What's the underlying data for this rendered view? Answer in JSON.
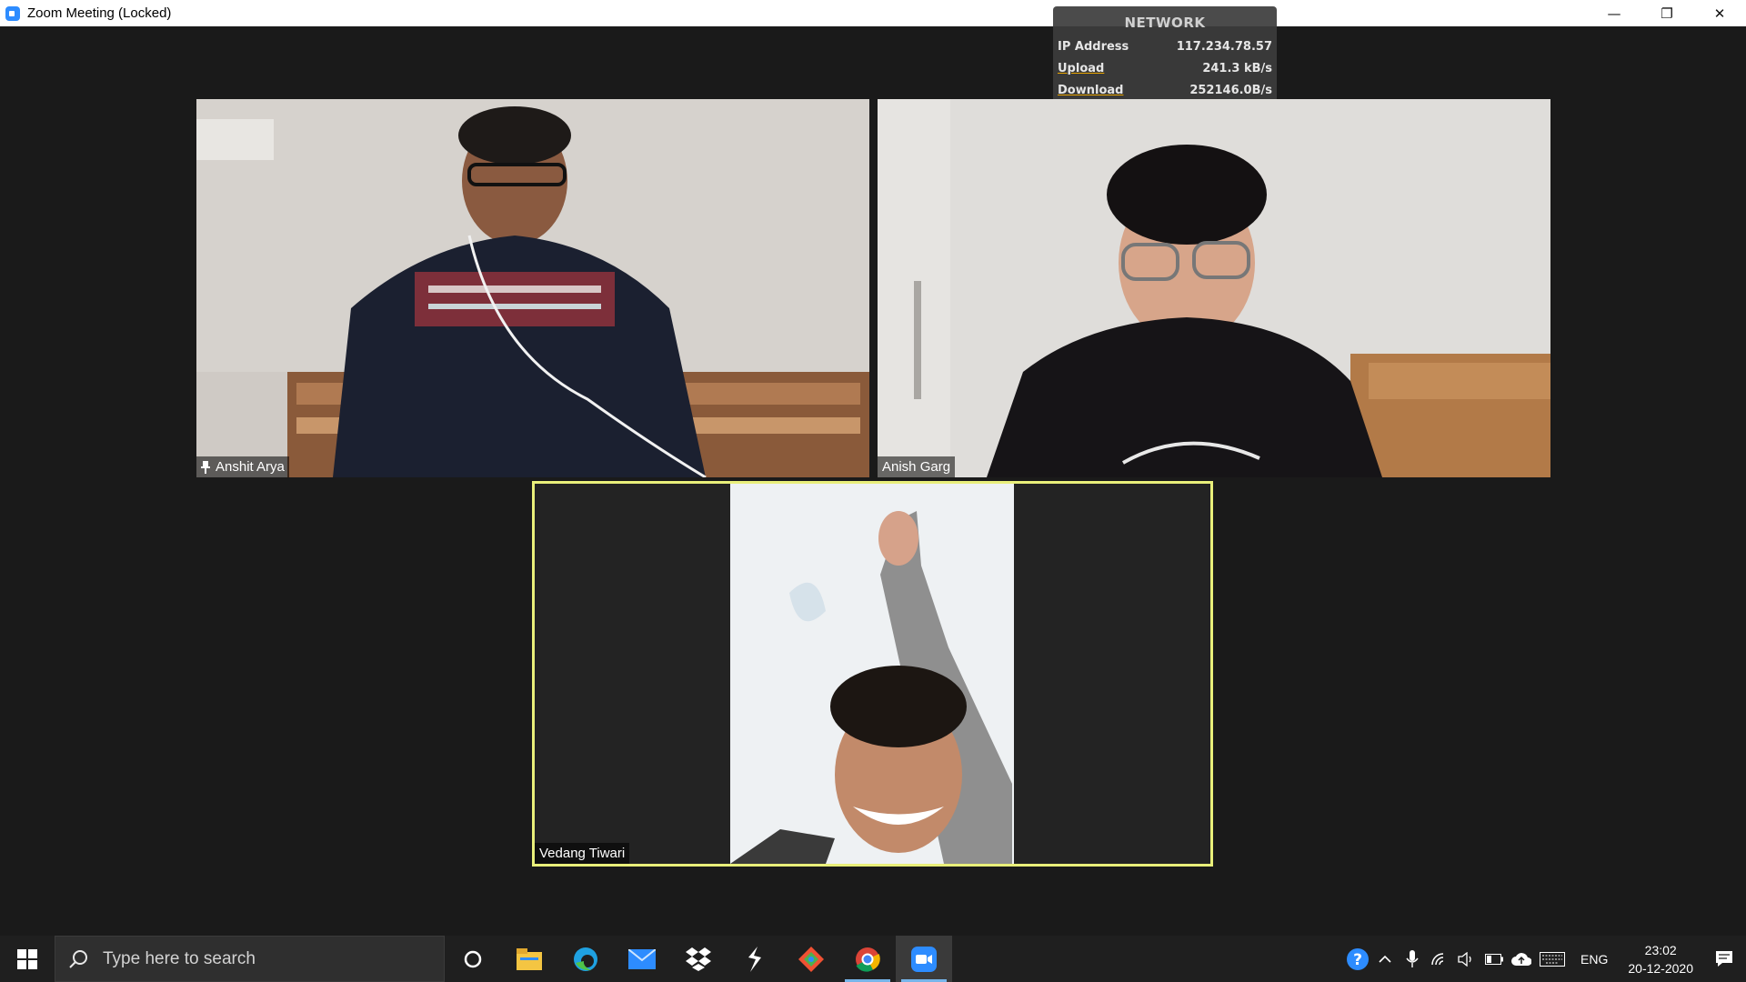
{
  "window": {
    "title": "Zoom Meeting (Locked)",
    "minimize_glyph": "—",
    "restore_glyph": "❐",
    "close_glyph": "✕",
    "app_icon": "zoom-icon"
  },
  "network_overlay": {
    "title": "NETWORK",
    "rows": [
      {
        "label": "IP Address",
        "value": "117.234.78.57"
      },
      {
        "label": "Upload",
        "value": "241.3 kB/s"
      },
      {
        "label": "Download",
        "value": "252146.0B/s"
      }
    ]
  },
  "participants": [
    {
      "name": "Anshit Arya",
      "pinned": true
    },
    {
      "name": "Anish Garg",
      "pinned": false
    },
    {
      "name": "Vedang Tiwari",
      "active_speaker": true
    }
  ],
  "taskbar": {
    "search_placeholder": "Type here to search",
    "apps": [
      "cortana-icon",
      "file-explorer-icon",
      "edge-icon",
      "mail-icon",
      "dropbox-icon",
      "sublime-icon",
      "git-icon",
      "chrome-icon",
      "zoom-icon"
    ],
    "language": "ENG",
    "time": "23:02",
    "date": "20-12-2020"
  },
  "colors": {
    "background": "#1a1a1a",
    "active_speaker_border": "#e9ef7a",
    "zoom_blue": "#2d8cff"
  }
}
